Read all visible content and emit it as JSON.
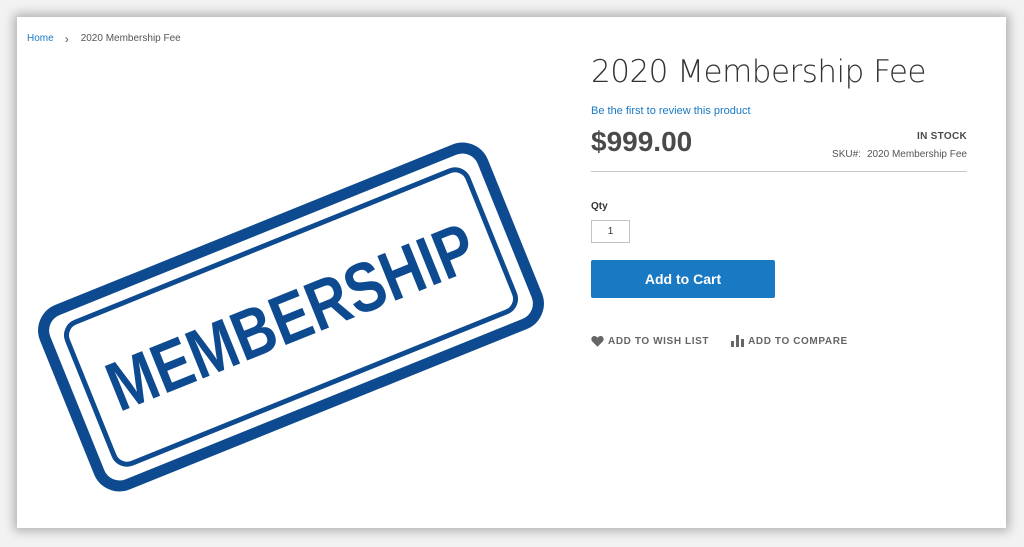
{
  "breadcrumb": {
    "home": "Home",
    "current": "2020 Membership Fee"
  },
  "product": {
    "title": "2020 Membership Fee",
    "review_link": "Be the first to review this product",
    "price": "$999.00",
    "stock_status": "IN STOCK",
    "sku_label": "SKU#:",
    "sku_value": "2020 Membership Fee",
    "image_text": "MEMBERSHIP",
    "image_icon": "membership-stamp-image",
    "stamp_color": "#0d4a8f"
  },
  "purchase": {
    "qty_label": "Qty",
    "qty_value": "1",
    "add_to_cart": "Add to Cart"
  },
  "actions": {
    "wish_list": "ADD TO WISH LIST",
    "compare": "ADD TO COMPARE",
    "wish_icon": "heart-icon",
    "compare_icon": "bar-chart-icon"
  },
  "colors": {
    "accent": "#1979c3",
    "link": "#1979c3"
  }
}
